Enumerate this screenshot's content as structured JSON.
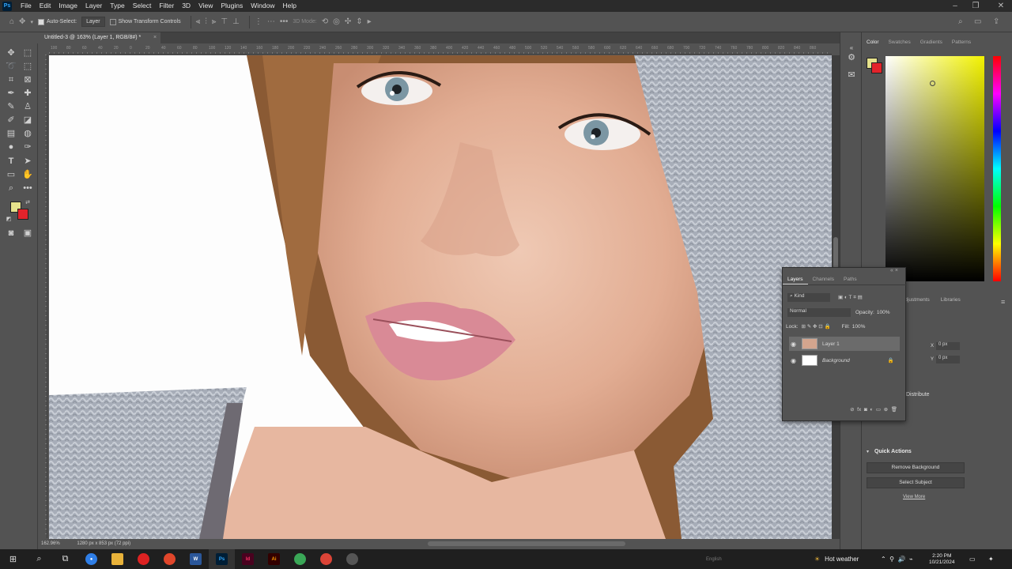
{
  "app": {
    "logo": "Ps"
  },
  "menu": [
    "File",
    "Edit",
    "Image",
    "Layer",
    "Type",
    "Select",
    "Filter",
    "3D",
    "View",
    "Plugins",
    "Window",
    "Help"
  ],
  "options_bar": {
    "auto_select_label": "Auto-Select:",
    "auto_select_value": "Layer",
    "transform_label": "Show Transform Controls",
    "mode_3d": "3D Mode:"
  },
  "document": {
    "tab_title": "Untitled-3 @ 163% (Layer 1, RGB/8#) *",
    "zoom": "162.96%",
    "size_info": "1280 px x 853 px (72 ppi)"
  },
  "ruler_ticks": [
    "100",
    "80",
    "60",
    "40",
    "20",
    "0",
    "20",
    "40",
    "60",
    "80",
    "100",
    "120",
    "140",
    "160",
    "180",
    "200",
    "220",
    "240",
    "260",
    "280",
    "300",
    "320",
    "340",
    "360",
    "380",
    "400",
    "420",
    "440",
    "460",
    "480",
    "500",
    "520",
    "540",
    "560",
    "580",
    "600",
    "620",
    "640",
    "660",
    "680",
    "700",
    "720",
    "740",
    "760",
    "780",
    "800",
    "820",
    "840",
    "860"
  ],
  "colors": {
    "foreground": "#e6e28c",
    "background": "#e3232b"
  },
  "right_panel": {
    "tabs": [
      "Color",
      "Swatches",
      "Gradients",
      "Patterns"
    ],
    "props_tabs": [
      "Adjustments",
      "Libraries"
    ],
    "x_label": "X",
    "x_value": "0 px",
    "y_label": "Y",
    "y_value": "0 px",
    "distribute": "Distribute",
    "quick_actions": "Quick Actions",
    "remove_bg": "Remove Background",
    "select_subject": "Select Subject",
    "view_more": "View More"
  },
  "layers_panel": {
    "tabs": [
      "Layers",
      "Channels",
      "Paths"
    ],
    "kind": "Kind",
    "blend": "Normal",
    "opacity_label": "Opacity:",
    "opacity": "100%",
    "lock_label": "Lock:",
    "fill_label": "Fill:",
    "fill": "100%",
    "layers": [
      {
        "name": "Layer 1"
      },
      {
        "name": "Background"
      }
    ]
  },
  "taskbar": {
    "weather": "Hot weather",
    "time": "2:20 PM",
    "date": "10/21/2024",
    "lang": "English"
  }
}
